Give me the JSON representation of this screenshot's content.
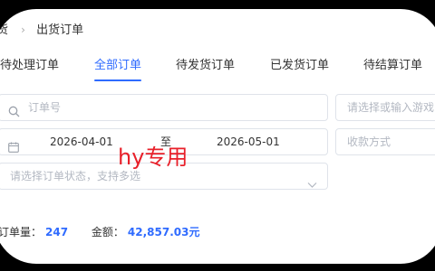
{
  "breadcrumb": {
    "parent": "货",
    "separator": "›",
    "current": "出货订单"
  },
  "tabs": [
    {
      "label": "待处理订单",
      "active": false
    },
    {
      "label": "全部订单",
      "active": true
    },
    {
      "label": "待发货订单",
      "active": false
    },
    {
      "label": "已发货订单",
      "active": false
    },
    {
      "label": "待结算订单",
      "active": false
    }
  ],
  "filters": {
    "order_no_placeholder": "订单号",
    "game_placeholder": "请选择或输入游戏",
    "date_start": "2026-04-01",
    "date_to": "至",
    "date_end": "2026-05-01",
    "payment_placeholder": "收款方式",
    "status_placeholder": "请选择订单状态，支持多选"
  },
  "watermark": "hy专用",
  "stats": {
    "order_count_label": "订单量：",
    "order_count": "247",
    "amount_label": "金额：",
    "amount": "42,857.03元"
  },
  "colors": {
    "accent": "#2f6bff",
    "watermark": "#e8202a"
  }
}
